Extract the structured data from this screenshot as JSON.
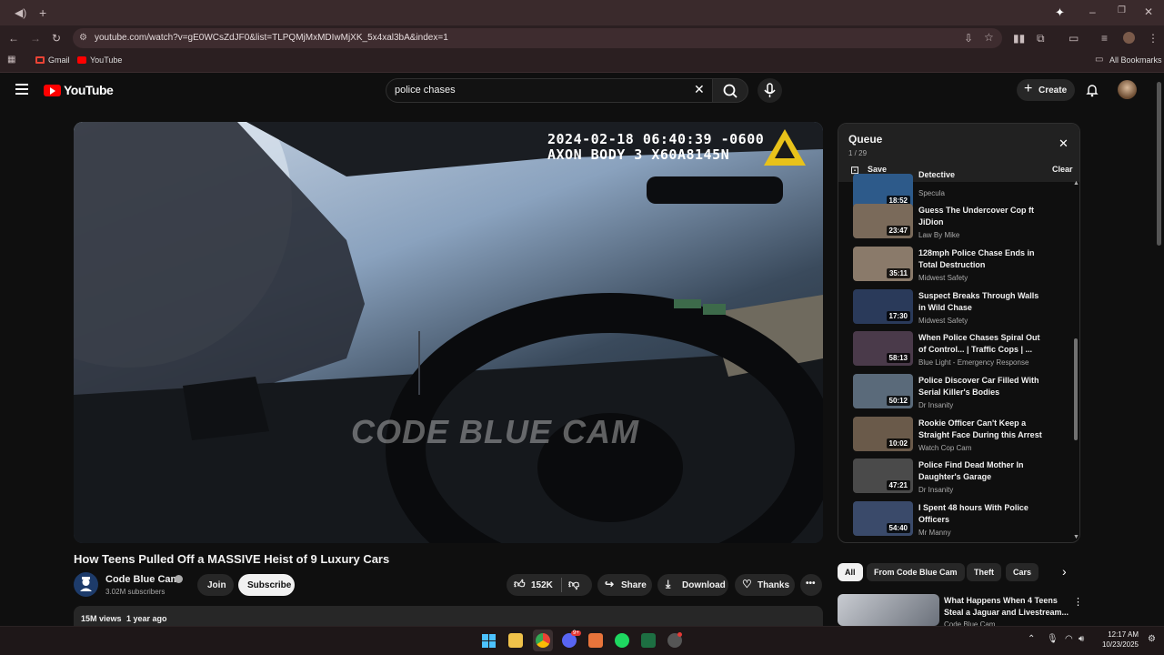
{
  "browser": {
    "url": "youtube.com/watch?v=gE0WCsZdJF0&list=TLPQMjMxMDIwMjXK_5x4xal3bA&index=1",
    "bookmarks": [
      {
        "label": "Gmail",
        "icon": "gmail-icon"
      },
      {
        "label": "YouTube",
        "icon": "youtube-icon"
      }
    ],
    "all_bookmarks": "All Bookmarks"
  },
  "youtube": {
    "logo_text": "YouTube",
    "search_value": "police chases",
    "create_label": "Create"
  },
  "video": {
    "overlay_timestamp": "2024-02-18 06:40:39 -0600",
    "overlay_device": "AXON BODY 3 X60A8145N",
    "watermark": "CODE BLUE CAM",
    "title": "How Teens Pulled Off a MASSIVE Heist of 9 Luxury Cars",
    "channel": "Code Blue Cam",
    "subscribers": "3.02M subscribers",
    "join_label": "Join",
    "subscribe_label": "Subscribe",
    "likes": "152K",
    "share_label": "Share",
    "download_label": "Download",
    "thanks_label": "Thanks",
    "views": "15M views",
    "age": "1 year ago"
  },
  "queue": {
    "title": "Queue",
    "position": "1 / 29",
    "save_label": "Save",
    "clear_label": "Clear",
    "items": [
      {
        "title": "Detective",
        "channel": "Specula",
        "duration": "18:52",
        "thumb": "#2d5a8a"
      },
      {
        "title": "Guess The Undercover Cop ft JiDion",
        "channel": "Law By Mike",
        "duration": "23:47",
        "thumb": "#7a6a5a"
      },
      {
        "title": "128mph Police Chase Ends in Total Destruction",
        "channel": "Midwest Safety",
        "duration": "35:11",
        "thumb": "#8a7a6a"
      },
      {
        "title": "Suspect Breaks Through Walls in Wild Chase",
        "channel": "Midwest Safety",
        "duration": "17:30",
        "thumb": "#2a3a5a"
      },
      {
        "title": "When Police Chases Spiral Out of Control... | Traffic Cops | ...",
        "channel": "Blue Light - Emergency Response",
        "duration": "58:13",
        "thumb": "#4a3a4a"
      },
      {
        "title": "Police Discover Car Filled With Serial Killer's Bodies",
        "channel": "Dr Insanity",
        "duration": "50:12",
        "thumb": "#5a6a7a"
      },
      {
        "title": "Rookie Officer Can't Keep a Straight Face During this Arrest",
        "channel": "Watch Cop Cam",
        "duration": "10:02",
        "thumb": "#6a5a4a"
      },
      {
        "title": "Police Find Dead Mother In Daughter's Garage",
        "channel": "Dr Insanity",
        "duration": "47:21",
        "thumb": "#4a4a4a"
      },
      {
        "title": "I Spent 48 hours With Police Officers",
        "channel": "Mr Manny",
        "duration": "54:40",
        "thumb": "#3a4a6a"
      }
    ]
  },
  "chips": [
    "All",
    "From Code Blue Cam",
    "Theft",
    "Cars"
  ],
  "recommended": {
    "title": "What Happens When 4 Teens Steal a Jaguar and Livestream...",
    "channel": "Code Blue Cam"
  },
  "system": {
    "time": "12:17 AM",
    "date": "10/23/2025",
    "discord_badge": "9+"
  }
}
